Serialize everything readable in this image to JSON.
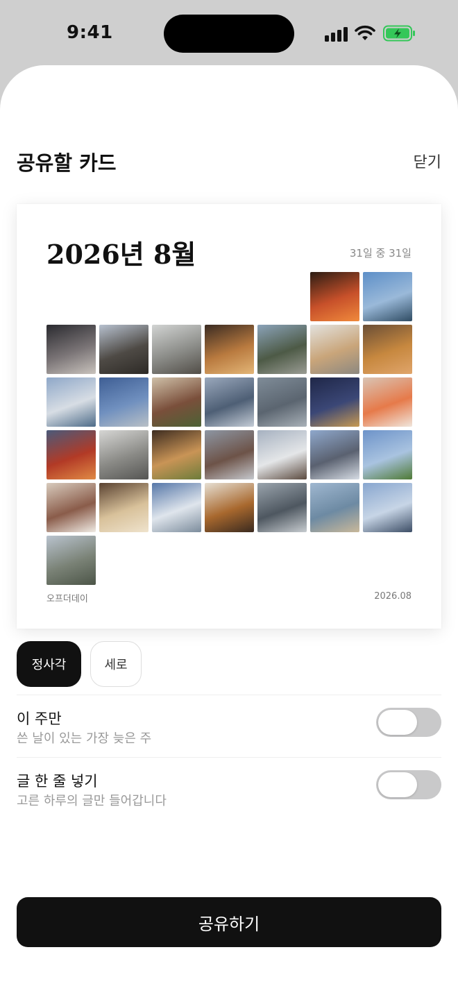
{
  "status_bar": {
    "time": "9:41"
  },
  "sheet": {
    "title": "공유할 카드",
    "close_label": "닫기"
  },
  "card": {
    "title": "2026년 8월",
    "count": "31일 중 31일",
    "brand": "오프더데이",
    "date": "2026.08",
    "leading_empty_cells": 5,
    "photos": [
      {
        "alt": "tokyo-tower-night",
        "colors": [
          "#2c1d14",
          "#c7502a",
          "#f08a3c"
        ]
      },
      {
        "alt": "harbor-blue-sky",
        "colors": [
          "#5d8fc8",
          "#9ab9d9",
          "#2f4c63"
        ]
      },
      {
        "alt": "cathedral-night",
        "colors": [
          "#2a2a2f",
          "#7a7476",
          "#c9c3bd"
        ]
      },
      {
        "alt": "mountain-street-dusk",
        "colors": [
          "#b7c1cf",
          "#4e4a45",
          "#2d2a26"
        ]
      },
      {
        "alt": "glass-arcade",
        "colors": [
          "#d2d4d3",
          "#8b8c88",
          "#514d47"
        ]
      },
      {
        "alt": "okonomiyaki",
        "colors": [
          "#3a2b22",
          "#b97a3f",
          "#e3b677"
        ]
      },
      {
        "alt": "trees-buildings",
        "colors": [
          "#8ba3b9",
          "#4d5a46",
          "#9a9c94"
        ]
      },
      {
        "alt": "soft-serve-cone",
        "colors": [
          "#e3e2de",
          "#c9a57a",
          "#8c8880"
        ]
      },
      {
        "alt": "seafood-platter",
        "colors": [
          "#6a4e36",
          "#c7883f",
          "#e0a56b"
        ]
      },
      {
        "alt": "mount-fuji",
        "colors": [
          "#8ea7c8",
          "#d7dde4",
          "#4d6b88"
        ]
      },
      {
        "alt": "blue-sky-statues",
        "colors": [
          "#3e5e94",
          "#7090bf",
          "#b9c0c6"
        ]
      },
      {
        "alt": "hand-snack",
        "colors": [
          "#cfc0a8",
          "#7a4f3b",
          "#4c6235"
        ]
      },
      {
        "alt": "lake-clouds",
        "colors": [
          "#9aa8bc",
          "#4e5f75",
          "#c4ccd6"
        ]
      },
      {
        "alt": "water-ripples",
        "colors": [
          "#7f8c98",
          "#5b6570",
          "#a9b1b8"
        ]
      },
      {
        "alt": "city-night-view",
        "colors": [
          "#1f2748",
          "#3b4776",
          "#c89a52"
        ]
      },
      {
        "alt": "sushi-plate",
        "colors": [
          "#d9c4b4",
          "#e67a4a",
          "#f0e6dc"
        ]
      },
      {
        "alt": "red-temple-gate",
        "colors": [
          "#4a5a7a",
          "#b23a26",
          "#e08a45"
        ]
      },
      {
        "alt": "white-shrine-carving",
        "colors": [
          "#d6d6d4",
          "#8a8a86",
          "#555553"
        ]
      },
      {
        "alt": "yakisoba",
        "colors": [
          "#3d2c20",
          "#c99456",
          "#6d7c3a"
        ]
      },
      {
        "alt": "hotel-building",
        "colors": [
          "#8d96a3",
          "#6d5348",
          "#c5c8cd"
        ]
      },
      {
        "alt": "snowy-mountain-signpost",
        "colors": [
          "#a6b1c0",
          "#e4e6e8",
          "#5b4a3f"
        ]
      },
      {
        "alt": "buddha-statue-dome",
        "colors": [
          "#8fa8cc",
          "#5a6170",
          "#d6dce4"
        ]
      },
      {
        "alt": "green-park-sky",
        "colors": [
          "#6d93c9",
          "#a9c3e0",
          "#4f7a36"
        ]
      },
      {
        "alt": "cafe-dessert",
        "colors": [
          "#d8cbbd",
          "#8a5c4a",
          "#f0ebe4"
        ]
      },
      {
        "alt": "dumplings-bowl",
        "colors": [
          "#5a4231",
          "#d8c19a",
          "#efe3cd"
        ]
      },
      {
        "alt": "clouds-pier",
        "colors": [
          "#5677a8",
          "#dfe5ec",
          "#7c8c9c"
        ]
      },
      {
        "alt": "curry-bowl",
        "colors": [
          "#e6dfd3",
          "#a8682e",
          "#3a2a1f"
        ]
      },
      {
        "alt": "tall-tower",
        "colors": [
          "#9aa4ad",
          "#4e5760",
          "#c7ccd0"
        ]
      },
      {
        "alt": "beach-shore",
        "colors": [
          "#9fb7d0",
          "#6d8aa3",
          "#c9b89a"
        ]
      },
      {
        "alt": "lantern-monument",
        "colors": [
          "#88a6cf",
          "#c7d5e6",
          "#3d4e66"
        ]
      },
      {
        "alt": "city-overlook",
        "colors": [
          "#b9c3ce",
          "#7a8276",
          "#4c5548"
        ]
      }
    ]
  },
  "layout_toggle": {
    "square_label": "정사각",
    "portrait_label": "세로",
    "selected": "square"
  },
  "options": {
    "this_week": {
      "title": "이 주만",
      "subtitle": "쓴 날이 있는 가장 늦은 주",
      "enabled": false
    },
    "add_text": {
      "title": "글 한 줄 넣기",
      "subtitle": "고른 하루의 글만 들어갑니다",
      "enabled": false
    }
  },
  "share_button": {
    "label": "공유하기"
  }
}
